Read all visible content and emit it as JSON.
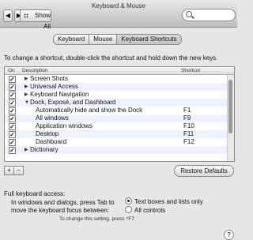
{
  "window": {
    "title": "Keyboard & Mouse"
  },
  "toolbar": {
    "show_all_label": "Show All",
    "search_placeholder": ""
  },
  "tabs": [
    {
      "label": "Keyboard",
      "active": false
    },
    {
      "label": "Mouse",
      "active": false
    },
    {
      "label": "Keyboard Shortcuts",
      "active": true
    }
  ],
  "instruction": "To change a shortcut, double-click the shortcut and hold down the new keys.",
  "table": {
    "headers": {
      "on": "On",
      "description": "Description",
      "shortcut": "Shortcut"
    },
    "rows": [
      {
        "checked": true,
        "expander": "▶",
        "description": "Screen Shots",
        "shortcut": "",
        "indent": 0
      },
      {
        "checked": true,
        "expander": "▶",
        "description": "Universal Access",
        "shortcut": "",
        "indent": 0
      },
      {
        "checked": true,
        "expander": "▶",
        "description": "Keyboard Navigation",
        "shortcut": "",
        "indent": 0
      },
      {
        "checked": true,
        "expander": "▼",
        "description": "Dock, Exposé, and Dashboard",
        "shortcut": "",
        "indent": 0
      },
      {
        "checked": true,
        "expander": "",
        "description": "Automatically hide and show the Dock",
        "shortcut": "F1",
        "indent": 1
      },
      {
        "checked": true,
        "expander": "",
        "description": "All windows",
        "shortcut": "F9",
        "indent": 1
      },
      {
        "checked": true,
        "expander": "",
        "description": "Application windows",
        "shortcut": "F10",
        "indent": 1
      },
      {
        "checked": true,
        "expander": "",
        "description": "Desktop",
        "shortcut": "F11",
        "indent": 1
      },
      {
        "checked": true,
        "expander": "",
        "description": "Dashboard",
        "shortcut": "F12",
        "indent": 1
      },
      {
        "checked": true,
        "expander": "▶",
        "description": "Dictionary",
        "shortcut": "",
        "indent": 0
      }
    ]
  },
  "buttons": {
    "add": "+",
    "remove": "−",
    "restore_defaults": "Restore Defaults"
  },
  "full_keyboard_access": {
    "title": "Full keyboard access:",
    "hint_line1": "In windows and dialogs, press Tab to",
    "hint_line2": "move the keyboard focus between:",
    "options": [
      {
        "label": "Text boxes and lists only",
        "selected": true
      },
      {
        "label": "All controls",
        "selected": false
      }
    ],
    "note": "To change this setting, press ^F7."
  },
  "help_label": "?"
}
